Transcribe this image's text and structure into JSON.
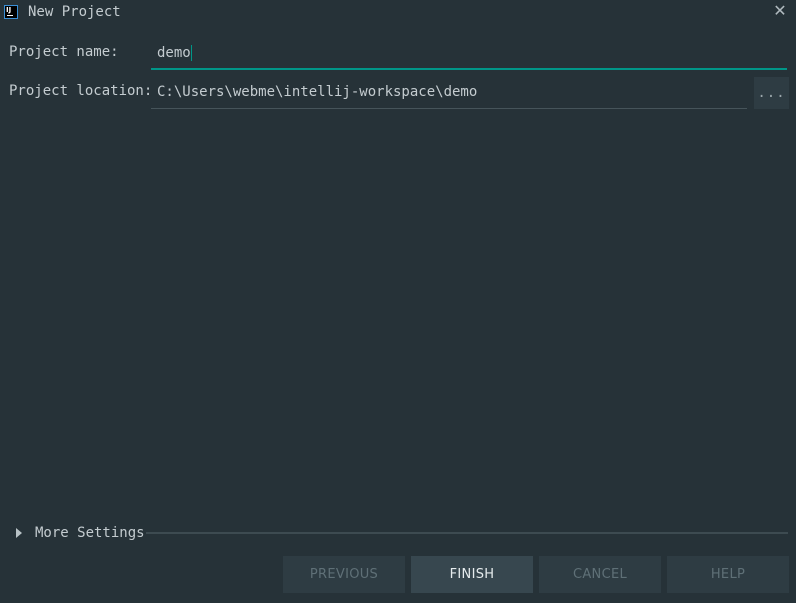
{
  "window": {
    "title": "New Project",
    "app_icon_text": "IJ"
  },
  "form": {
    "project_name_label": "Project name:",
    "project_name_value": "demo",
    "project_location_label": "Project location:",
    "project_location_value": "C:\\Users\\webme\\intellij-workspace\\demo",
    "browse_label": "..."
  },
  "more_settings": {
    "label": "More Settings",
    "expanded": false
  },
  "buttons": {
    "previous": "PREVIOUS",
    "finish": "FINISH",
    "cancel": "CANCEL",
    "help": "HELP"
  },
  "colors": {
    "background": "#263238",
    "accent": "#009688",
    "button_bg": "#2e3c43",
    "primary_button_bg": "#37474f"
  }
}
